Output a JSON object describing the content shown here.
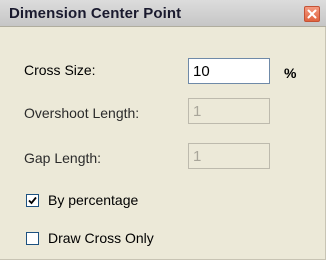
{
  "window": {
    "title": "Dimension Center Point"
  },
  "icons": {
    "close": "close-icon",
    "check": "checkmark-icon"
  },
  "colors": {
    "titlebar": "#d0d0d0",
    "close_button": "#e0633f",
    "dialog_bg": "#ece9d8"
  },
  "fields": {
    "cross_size": {
      "label": "Cross Size:",
      "value": "10",
      "unit": "%"
    },
    "overshoot_length": {
      "label": "Overshoot Length:",
      "value": "1"
    },
    "gap_length": {
      "label": "Gap Length:",
      "value": "1"
    }
  },
  "options": {
    "by_percentage": {
      "label": "By percentage",
      "checked": true
    },
    "draw_cross_only": {
      "label": "Draw Cross Only",
      "checked": false
    }
  }
}
